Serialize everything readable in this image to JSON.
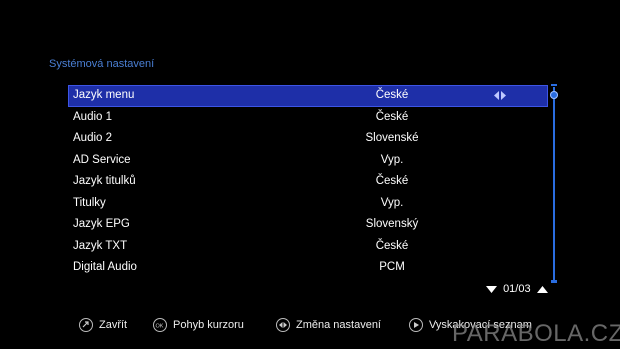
{
  "page": {
    "title": "Systémová nastavení",
    "watermark": "PARABOLA.CZ"
  },
  "menu": {
    "selected_index": 0,
    "items": [
      {
        "label": "Jazyk menu",
        "value": "České"
      },
      {
        "label": "Audio 1",
        "value": "České"
      },
      {
        "label": "Audio 2",
        "value": "Slovenské"
      },
      {
        "label": "AD Service",
        "value": "Vyp."
      },
      {
        "label": "Jazyk titulků",
        "value": "České"
      },
      {
        "label": "Titulky",
        "value": "Vyp."
      },
      {
        "label": "Jazyk EPG",
        "value": "Slovenský"
      },
      {
        "label": "Jazyk TXT",
        "value": "České"
      },
      {
        "label": "Digital Audio",
        "value": "PCM"
      }
    ]
  },
  "pager": {
    "text": "01/03",
    "current": 1,
    "total": 3
  },
  "footer": {
    "buttons": [
      {
        "label": "Zavřít",
        "icon": "exit-icon"
      },
      {
        "label": "Pohyb kurzoru",
        "icon": "ok-nav-icon"
      },
      {
        "label": "Změna nastavení",
        "icon": "left-right-icon"
      },
      {
        "label": "Vyskakovací seznam",
        "icon": "ok-list-icon"
      }
    ]
  },
  "colors": {
    "title": "#4a7fd4",
    "selection": "#1e2fa8",
    "scrollbar": "#2a6de0"
  }
}
